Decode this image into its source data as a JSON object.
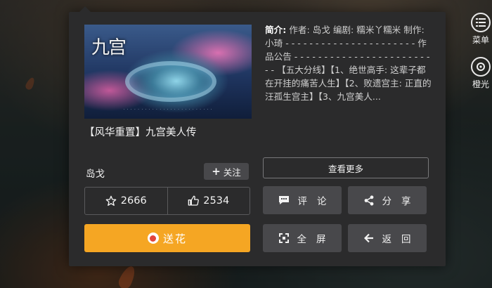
{
  "side_menu": [
    {
      "label": "菜单",
      "icon": "menu-list-icon"
    },
    {
      "label": "橙光",
      "icon": "orange-light-logo-icon"
    }
  ],
  "work": {
    "title": "【风华重置】九宫美人传",
    "poster_logo": "九宫",
    "author": "岛戈",
    "follow_label": "关注",
    "description_label": "简介:",
    "description": "作者: 岛戈 编剧: 糯米丫糯米 制作: 小琦 - - - - - - - - - - - - - - - - - - - - - - 作品公告 - - - - - - - - - - - - - - - - - - - - - - - - - 【五大分线】【1、绝世高手: 这辈子都在开挂的痛苦人生】【2、败遗宫主: 正直的汪孤生宫主】【3、九宫美人...",
    "more_label": "查看更多"
  },
  "stats": {
    "stars": "2666",
    "likes": "2534"
  },
  "actions": {
    "flower": "送花",
    "comment": "评论",
    "share": "分享",
    "fullscreen": "全屏",
    "back": "返回"
  },
  "colors": {
    "accent": "#f5a623",
    "panel_bg": "#2b2b2c",
    "button_bg": "#48484b"
  }
}
